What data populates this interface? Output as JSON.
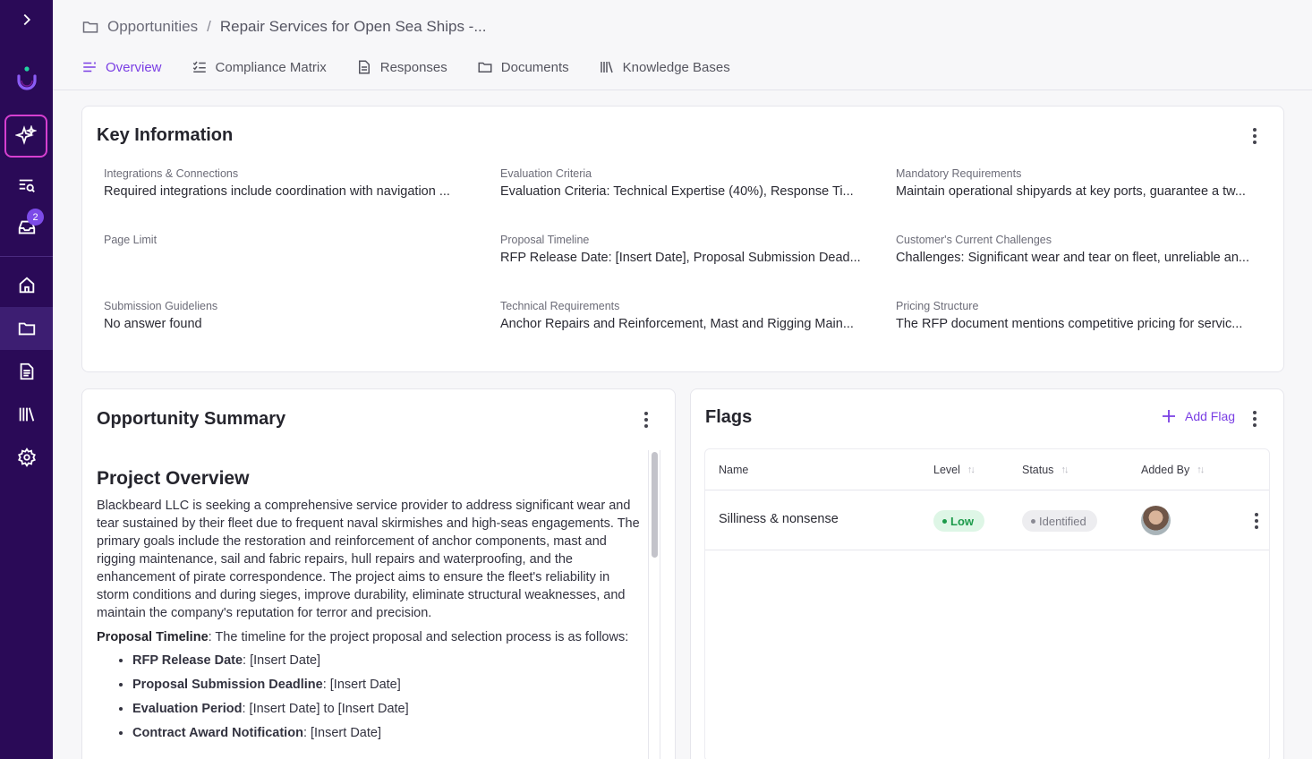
{
  "sidebar": {
    "inbox_badge": "2"
  },
  "breadcrumb": {
    "root": "Opportunities",
    "current": "Repair Services for Open Sea Ships -...",
    "separator": "/"
  },
  "tabs": [
    {
      "label": "Overview"
    },
    {
      "label": "Compliance Matrix"
    },
    {
      "label": "Responses"
    },
    {
      "label": "Documents"
    },
    {
      "label": "Knowledge Bases"
    }
  ],
  "key_information": {
    "title": "Key Information",
    "items": [
      {
        "label": "Integrations & Connections",
        "value": "Required integrations include coordination with navigation ..."
      },
      {
        "label": "Evaluation Criteria",
        "value": "Evaluation Criteria: Technical Expertise (40%), Response Ti..."
      },
      {
        "label": "Mandatory Requirements",
        "value": "Maintain operational shipyards at key ports, guarantee a tw..."
      },
      {
        "label": "Page Limit",
        "value": ""
      },
      {
        "label": "Proposal Timeline",
        "value": "RFP Release Date: [Insert Date], Proposal Submission Dead..."
      },
      {
        "label": "Customer's Current Challenges",
        "value": "Challenges: Significant wear and tear on fleet, unreliable an..."
      },
      {
        "label": "Submission Guideliens",
        "value": "No answer found"
      },
      {
        "label": "Technical Requirements",
        "value": "Anchor Repairs and Reinforcement, Mast and Rigging Main..."
      },
      {
        "label": "Pricing Structure",
        "value": "The RFP document mentions competitive pricing for servic..."
      }
    ]
  },
  "opportunity_summary": {
    "title": "Opportunity Summary",
    "heading": "Project Overview",
    "paragraph": "Blackbeard LLC is seeking a comprehensive service provider to address significant wear and tear sustained by their fleet due to frequent naval skirmishes and high-seas engagements. The primary goals include the restoration and reinforcement of anchor components, mast and rigging maintenance, sail and fabric repairs, hull repairs and waterproofing, and the enhancement of pirate correspondence. The project aims to ensure the fleet's reliability in storm conditions and during sieges, improve durability, eliminate structural weaknesses, and maintain the company's reputation for terror and precision.",
    "timeline_label": "Proposal Timeline",
    "timeline_text": ": The timeline for the project proposal and selection process is as follows:",
    "timeline_items": [
      {
        "label": "RFP Release Date",
        "value": ": [Insert Date]"
      },
      {
        "label": "Proposal Submission Deadline",
        "value": ": [Insert Date]"
      },
      {
        "label": "Evaluation Period",
        "value": ": [Insert Date] to [Insert Date]"
      },
      {
        "label": "Contract Award Notification",
        "value": ": [Insert Date]"
      }
    ]
  },
  "flags": {
    "title": "Flags",
    "add_label": "Add Flag",
    "columns": {
      "name": "Name",
      "level": "Level",
      "status": "Status",
      "added_by": "Added By"
    },
    "rows": [
      {
        "name": "Silliness & nonsense",
        "level": "Low",
        "status": "Identified"
      }
    ]
  }
}
